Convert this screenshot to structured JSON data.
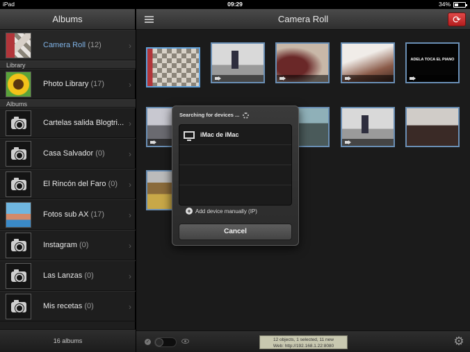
{
  "status_bar": {
    "device": "iPad",
    "time": "09:29",
    "battery": "34%",
    "battery_level": 0.34
  },
  "sidebar": {
    "title": "Albums",
    "selected": {
      "label": "Camera Roll",
      "count": "(12)"
    },
    "library_section": "Library",
    "library_item": {
      "label": "Photo Library",
      "count": "(17)"
    },
    "albums_section": "Albums",
    "albums": [
      {
        "label": "Cartelas salida Blogtri...",
        "count": ""
      },
      {
        "label": "Casa Salvador",
        "count": "(0)"
      },
      {
        "label": "El Rincón del Faro",
        "count": "(0)"
      },
      {
        "label": "Fotos sub AX",
        "count": "(17)"
      },
      {
        "label": "Instagram",
        "count": "(0)"
      },
      {
        "label": "Las Lanzas",
        "count": "(0)"
      },
      {
        "label": "Mis recetas",
        "count": "(0)"
      }
    ],
    "footer": "16 albums"
  },
  "main": {
    "title": "Camera Roll",
    "menu_icon": "hamburger-icon",
    "sync_icon": "sync-icon",
    "piano_caption": "ADELA TOCA EL PIANO"
  },
  "popup": {
    "searching": "Searching for devices ...",
    "device": "iMac de iMac",
    "add_manual": "Add device manually (IP)",
    "cancel": "Cancel"
  },
  "footer": {
    "status_line1": "12 objects, 1 selected, 11 new",
    "status_line2": "Web: http://192.168.1.22:8080",
    "settings_icon": "gear-icon"
  },
  "colors": {
    "selection": "#5fa0da",
    "sync_button": "#c82a2a",
    "selected_text": "#7fb2e5"
  }
}
